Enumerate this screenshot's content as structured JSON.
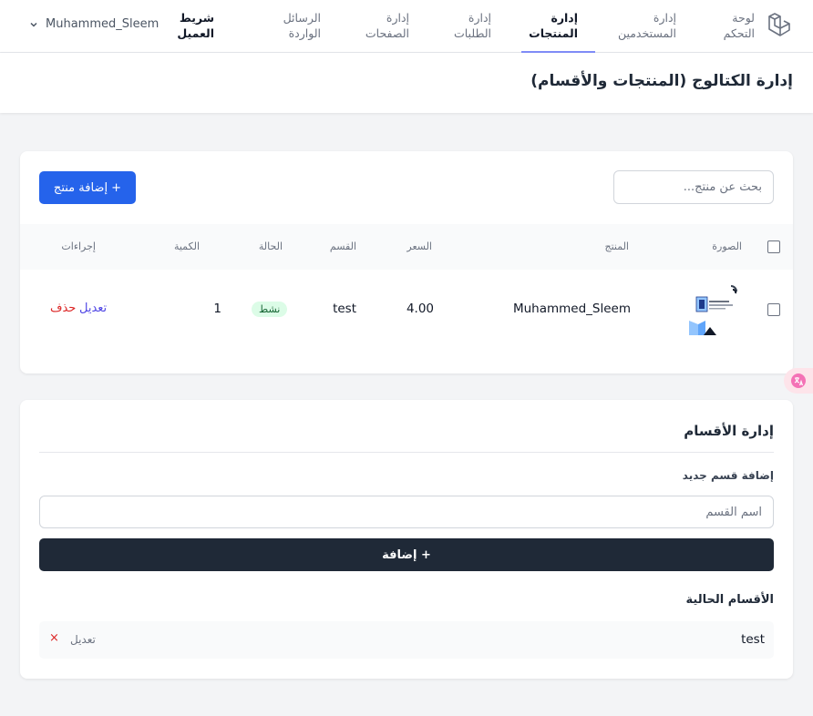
{
  "nav": {
    "items": [
      {
        "label": "لوحة\nالتحكم"
      },
      {
        "label": "إدارة\nالمستخدمين"
      },
      {
        "label": "إدارة\nالمنتجات"
      },
      {
        "label": "إدارة\nالطلبات"
      },
      {
        "label": "إدارة\nالصفحات"
      },
      {
        "label": "الرسائل\nالواردة"
      },
      {
        "label": "شريط\nالعميل"
      }
    ],
    "active_index": 2,
    "user_name": "Muhammed_Sleem"
  },
  "page": {
    "title": "إدارة الكتالوج (المنتجات والأقسام)"
  },
  "products": {
    "search_placeholder": "بحث عن منتج...",
    "add_button": "+ إضافة منتج",
    "columns": {
      "image": "الصورة",
      "product": "المنتج",
      "price": "السعر",
      "category": "القسم",
      "status": "الحالة",
      "quantity": "الكمية",
      "actions": "إجراءات"
    },
    "rows": [
      {
        "name": "Muhammed_Sleem",
        "price": "4.00",
        "category": "test",
        "status": "نشط",
        "quantity": "1",
        "edit": "تعديل",
        "delete": "حذف"
      }
    ]
  },
  "categories": {
    "title": "إدارة الأقسام",
    "add_label": "إضافة قسم جديد",
    "input_placeholder": "اسم القسم",
    "add_button": "+ إضافة",
    "current_title": "الأقسام الحالية",
    "items": [
      {
        "name": "test",
        "edit": "تعديل",
        "delete": "×"
      }
    ]
  },
  "colors": {
    "primary": "#2563eb",
    "dark_button": "#1f2937",
    "danger": "#dc2626",
    "link": "#4f46e5",
    "active_underline": "#818cf8"
  }
}
